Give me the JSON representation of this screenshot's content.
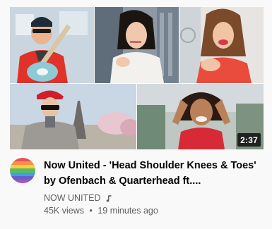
{
  "video": {
    "title": "Now United - 'Head Shoulder Knees & Toes' by Ofenbach & Quarterhead ft....",
    "duration": "2:37",
    "channel": "NOW UNITED",
    "channel_badge_icon": "music-note-icon",
    "views": "45K views",
    "separator": "•",
    "age": "19 minutes ago"
  },
  "colors": {
    "title": "#030303",
    "secondary_text": "#606060",
    "badge_bg": "#111111",
    "page_bg": "#f9f9f9"
  }
}
